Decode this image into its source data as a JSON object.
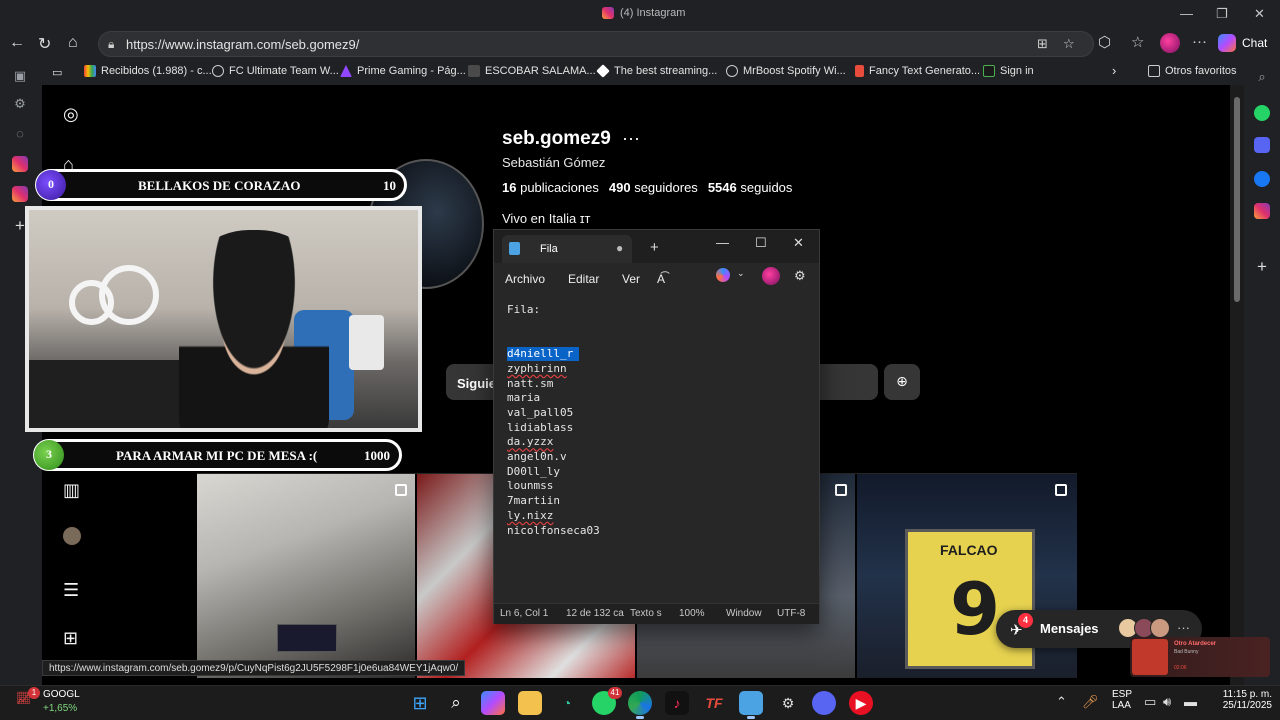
{
  "browser": {
    "tab_title": "(4) Instagram",
    "url": "https://www.instagram.com/seb.gomez9/",
    "chat_label": "Chat",
    "bookmarks": [
      "Recibidos (1.988) - c...",
      "FC Ultimate Team W...",
      "Prime Gaming - Pág...",
      "ESCOBAR SALAMA...",
      "The best streaming...",
      "MrBoost Spotify Wi...",
      "Fancy Text Generato...",
      "Sign in"
    ],
    "other_favorites": "Otros favoritos",
    "status_url": "https://www.instagram.com/seb.gomez9/p/CuyNqPist6g2JU5F5298F1j0e6ua84WEY1jAqw0/"
  },
  "profile": {
    "username": "seb.gomez9",
    "more": "···",
    "real_name": "Sebastián Gómez",
    "posts_count": "16",
    "posts_label": "publicaciones",
    "followers_count": "490",
    "followers_label": "seguidores",
    "following_count": "5546",
    "following_label": "seguidos",
    "bio": "Vivo en Italia ",
    "bio_glyph": "ɪт",
    "follow_button": "Siguie",
    "jersey_name": "FALCAO",
    "jersey_number": "9"
  },
  "overlay": {
    "top_bar": {
      "count": "0",
      "label": "BELLAKOS DE CORAZAO",
      "goal": "10"
    },
    "bottom_bar": {
      "count": "3",
      "label": "PARA ARMAR MI PC DE MESA :(",
      "goal": "1000"
    }
  },
  "notepad": {
    "tab_title": "Fila",
    "menu": [
      "Archivo",
      "Editar",
      "Ver"
    ],
    "lines": [
      {
        "text": "Fila:",
        "selected": false,
        "squiggle": false
      },
      {
        "text": "",
        "selected": false,
        "squiggle": false
      },
      {
        "text": "",
        "selected": false,
        "squiggle": false
      },
      {
        "text": "d4nielll_r",
        "selected": true,
        "squiggle": false
      },
      {
        "text": "zyphirinn",
        "selected": false,
        "squiggle": true
      },
      {
        "text": "natt.sm",
        "selected": false,
        "squiggle": false
      },
      {
        "text": "maria",
        "selected": false,
        "squiggle": false
      },
      {
        "text": "val_pall05",
        "selected": false,
        "squiggle": false
      },
      {
        "text": "lidiablass",
        "selected": false,
        "squiggle": false
      },
      {
        "text": "da.yzzx",
        "selected": false,
        "squiggle": true
      },
      {
        "text": "angel0n.v",
        "selected": false,
        "squiggle": false
      },
      {
        "text": "D00ll_ly",
        "selected": false,
        "squiggle": false
      },
      {
        "text": "lounmss",
        "selected": false,
        "squiggle": false
      },
      {
        "text": "7martiin",
        "selected": false,
        "squiggle": false
      },
      {
        "text": "ly.nixz",
        "selected": false,
        "squiggle": true
      },
      {
        "text": "nicolfonseca03",
        "selected": false,
        "squiggle": false
      }
    ],
    "status": {
      "position": "Ln 6, Col 1",
      "chars": "12 de 132 ca",
      "format": "Texto s",
      "zoom": "100%",
      "eol": "Window",
      "encoding": "UTF-8"
    }
  },
  "messages": {
    "label": "Mensajes",
    "badge": "4",
    "more": "···"
  },
  "media": {
    "title": "Otro Atardecer",
    "artist": "Bad Bunny",
    "time": "02:06"
  },
  "taskbar": {
    "stock_name": "GOOGL",
    "stock_change": "+1,65%",
    "stock_badge": "1",
    "whatsapp_badge": "41",
    "lang": "ESP",
    "lang2": "LAA",
    "time": "11:15 p. m.",
    "date": "25/11/2025"
  },
  "colors": {
    "selection": "#0a64c8",
    "overlay_circle_top": "#5b2bd6",
    "overlay_circle_bottom": "#42b02a",
    "notif_red": "#ff3040"
  }
}
